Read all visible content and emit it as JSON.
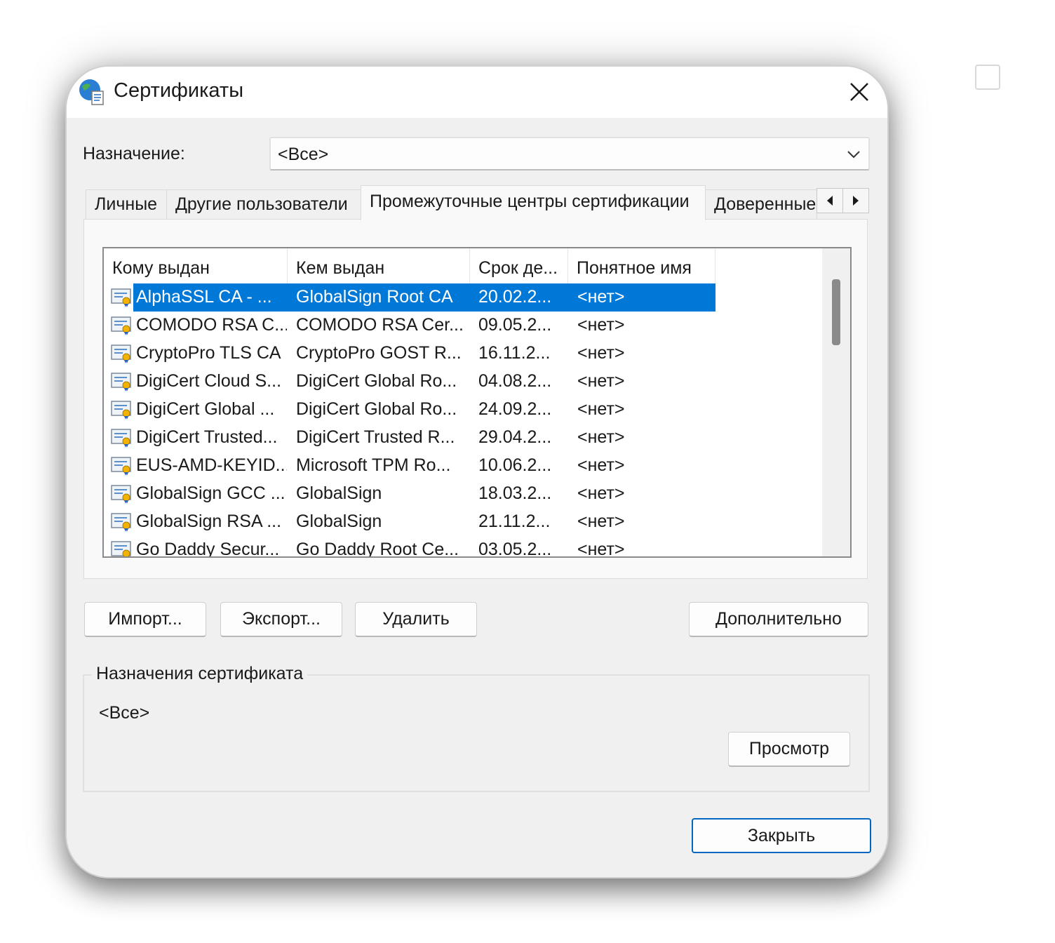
{
  "window": {
    "title": "Сертификаты",
    "close_glyph": "✕"
  },
  "purpose": {
    "label": "Назначение:",
    "selected": "<Все>"
  },
  "tabs": [
    {
      "label": "Личные",
      "active": false
    },
    {
      "label": "Другие пользователи",
      "active": false
    },
    {
      "label": "Промежуточные центры сертификации",
      "active": true
    },
    {
      "label": "Доверенные",
      "active": false
    }
  ],
  "tab_scroll": {
    "left": "◂",
    "right": "▸"
  },
  "columns": [
    "Кому выдан",
    "Кем выдан",
    "Срок де...",
    "Понятное имя"
  ],
  "rows": [
    {
      "issued_to": "AlphaSSL CA - ...",
      "issued_by": "GlobalSign Root CA",
      "expires": "20.02.2...",
      "friendly": "<нет>",
      "selected": true
    },
    {
      "issued_to": "COMODO RSA C...",
      "issued_by": "COMODO RSA Cer...",
      "expires": "09.05.2...",
      "friendly": "<нет>",
      "selected": false
    },
    {
      "issued_to": "CryptoPro TLS CA",
      "issued_by": "CryptoPro GOST R...",
      "expires": "16.11.2...",
      "friendly": "<нет>",
      "selected": false
    },
    {
      "issued_to": "DigiCert Cloud S...",
      "issued_by": "DigiCert Global Ro...",
      "expires": "04.08.2...",
      "friendly": "<нет>",
      "selected": false
    },
    {
      "issued_to": "DigiCert Global ...",
      "issued_by": "DigiCert Global Ro...",
      "expires": "24.09.2...",
      "friendly": "<нет>",
      "selected": false
    },
    {
      "issued_to": "DigiCert Trusted...",
      "issued_by": "DigiCert Trusted R...",
      "expires": "29.04.2...",
      "friendly": "<нет>",
      "selected": false
    },
    {
      "issued_to": "EUS-AMD-KEYID...",
      "issued_by": "Microsoft TPM Ro...",
      "expires": "10.06.2...",
      "friendly": "<нет>",
      "selected": false
    },
    {
      "issued_to": "GlobalSign GCC ...",
      "issued_by": "GlobalSign",
      "expires": "18.03.2...",
      "friendly": "<нет>",
      "selected": false
    },
    {
      "issued_to": "GlobalSign RSA ...",
      "issued_by": "GlobalSign",
      "expires": "21.11.2...",
      "friendly": "<нет>",
      "selected": false
    },
    {
      "issued_to": "Go Daddy Secur...",
      "issued_by": "Go Daddy Root Ce...",
      "expires": "03.05.2...",
      "friendly": "<нет>",
      "selected": false
    }
  ],
  "buttons": {
    "import": "Импорт...",
    "export": "Экспорт...",
    "delete": "Удалить",
    "advanced": "Дополнительно",
    "view": "Просмотр",
    "close": "Закрыть"
  },
  "cert_purposes": {
    "title": "Назначения сертификата",
    "value": "<Все>"
  },
  "colors": {
    "selection": "#0078d7",
    "dialog_bg": "#f0f0f0",
    "default_button_border": "#0067c0"
  },
  "icons": {
    "app": "certificates-globe-icon",
    "row": "certificate-icon",
    "close": "close-icon",
    "dropdown": "chevron-down-icon"
  }
}
